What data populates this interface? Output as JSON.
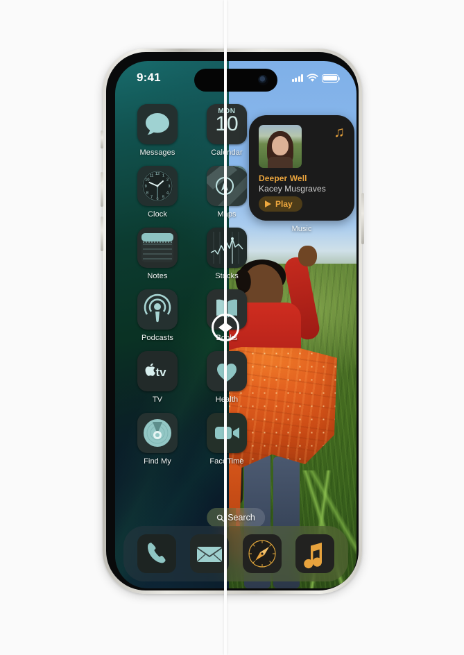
{
  "status_bar": {
    "time": "9:41",
    "cellular_icon": "cellular-bars-icon",
    "wifi_icon": "wifi-icon",
    "battery_icon": "battery-icon"
  },
  "home_screen": {
    "apps": [
      [
        {
          "label": "Messages",
          "icon": "messages-icon"
        },
        {
          "label": "Calendar",
          "icon": "calendar-icon",
          "weekday": "MON",
          "day": "10"
        }
      ],
      [
        {
          "label": "Clock",
          "icon": "clock-icon"
        },
        {
          "label": "Maps",
          "icon": "maps-icon"
        }
      ],
      [
        {
          "label": "Notes",
          "icon": "notes-icon"
        },
        {
          "label": "Stocks",
          "icon": "stocks-icon"
        }
      ],
      [
        {
          "label": "Podcasts",
          "icon": "podcasts-icon"
        },
        {
          "label": "Books",
          "icon": "books-icon"
        }
      ],
      [
        {
          "label": "TV",
          "icon": "apple-tv-icon"
        },
        {
          "label": "Health",
          "icon": "health-icon"
        }
      ],
      [
        {
          "label": "Find My",
          "icon": "find-my-icon"
        },
        {
          "label": "FaceTime",
          "icon": "facetime-icon"
        }
      ]
    ],
    "widget": {
      "app_label": "Music",
      "track_title": "Deeper Well",
      "artist": "Kacey Musgraves",
      "play_label": "Play",
      "note_icon": "music-note-icon",
      "play_icon": "play-triangle-icon",
      "artwork": "album-artwork"
    },
    "search": {
      "label": "Search",
      "icon": "search-magnifier-icon"
    },
    "dock": [
      {
        "label": "Phone",
        "icon": "phone-handset-icon"
      },
      {
        "label": "Mail",
        "icon": "mail-envelope-icon"
      },
      {
        "label": "Safari",
        "icon": "safari-compass-icon"
      },
      {
        "label": "Music",
        "icon": "music-note-icon"
      }
    ]
  },
  "comparison_slider": {
    "handle_icon": "left-right-arrows-icon",
    "left_arrow": "chevron-left-icon",
    "right_arrow": "chevron-right-icon"
  },
  "colors": {
    "accent_orange": "#e8a33d",
    "icon_tint": "#9fd2d2",
    "page_background": "#fafafa",
    "widget_background": "#1b1b1b"
  }
}
